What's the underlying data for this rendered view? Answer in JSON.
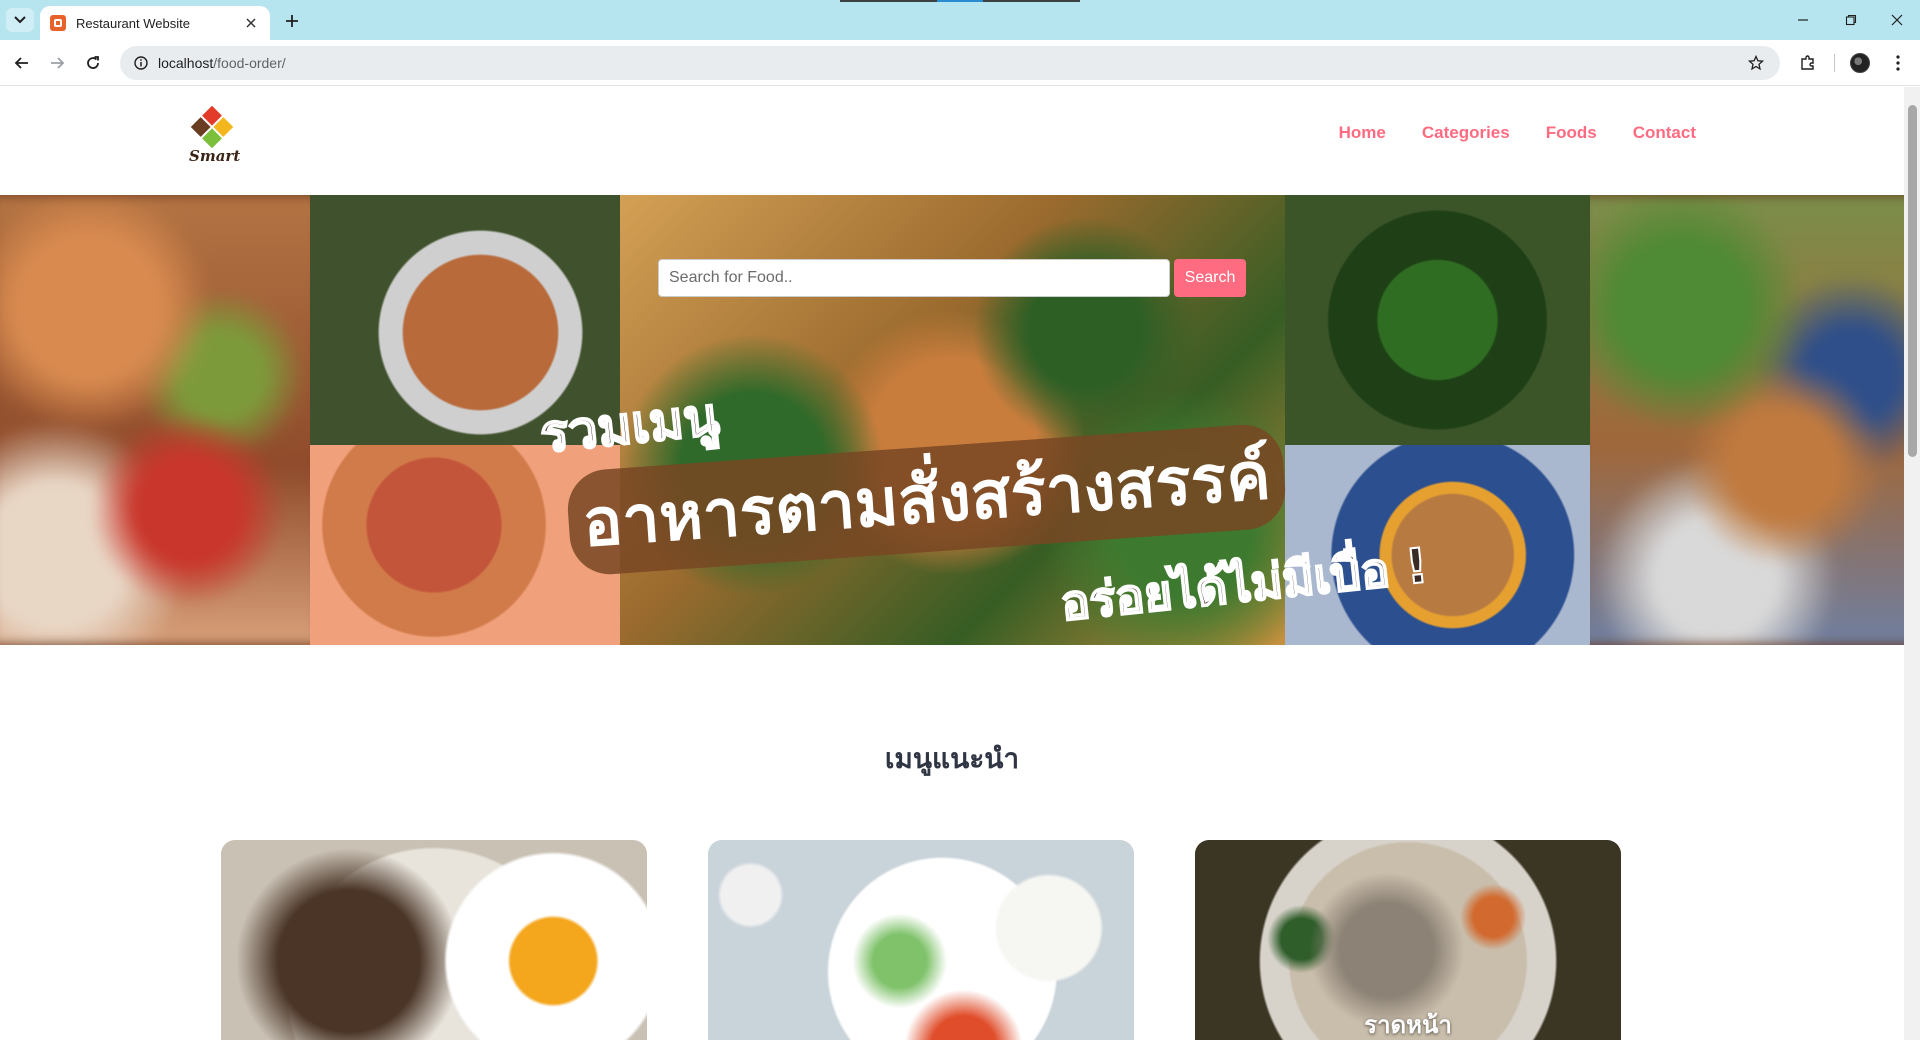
{
  "browser": {
    "tab_title": "Restaurant Website",
    "url_host": "localhost",
    "url_path": "/food-order/"
  },
  "header": {
    "logo_text": "Smart",
    "nav": [
      {
        "label": "Home"
      },
      {
        "label": "Categories"
      },
      {
        "label": "Foods"
      },
      {
        "label": "Contact"
      }
    ]
  },
  "hero": {
    "search_placeholder": "Search for Food..",
    "search_button": "Search",
    "banner_line1": "รวมเมนู",
    "banner_line2": "อาหารตามสั่งสร้างสรรค์",
    "banner_line3": "อร่อยได้ไม่มีเบื่อ !"
  },
  "featured": {
    "title": "เมนูแนะนำ",
    "cards": [
      {
        "label": ""
      },
      {
        "label": ""
      },
      {
        "label": "ราดหน้า"
      }
    ]
  },
  "colors": {
    "accent": "#ff6b81",
    "heading": "#2f3542",
    "tabstrip": "#b6e4ef"
  }
}
